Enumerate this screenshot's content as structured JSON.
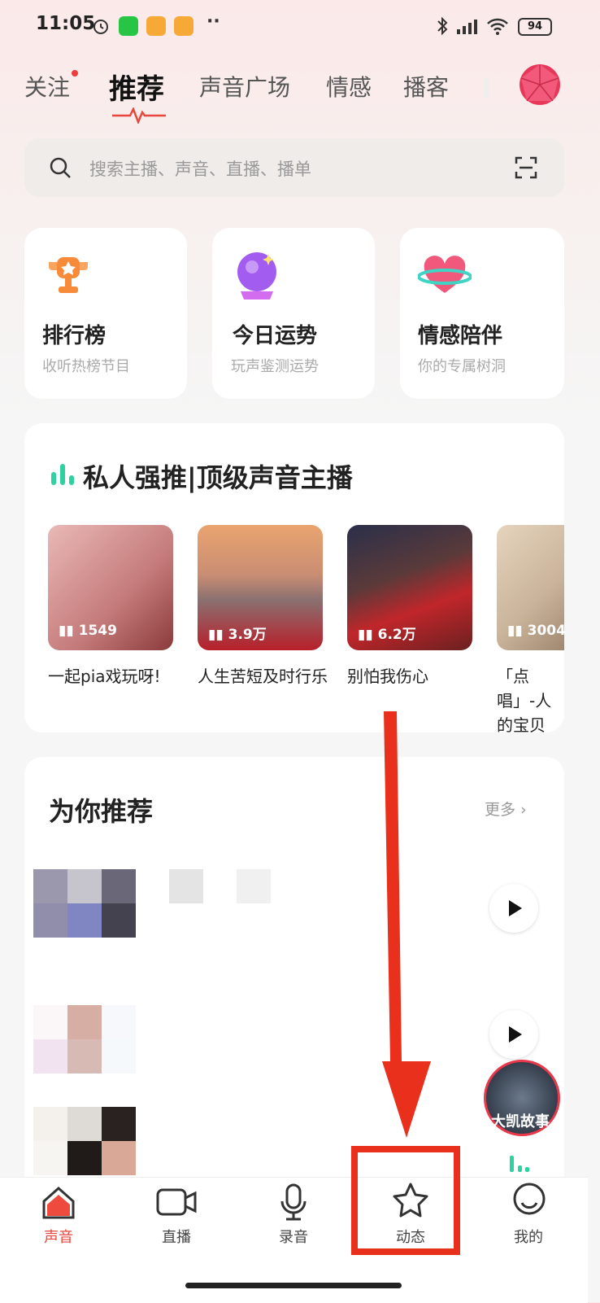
{
  "status_bar": {
    "time": "11:05",
    "battery": "94"
  },
  "tabs": [
    {
      "label": "关注"
    },
    {
      "label": "推荐"
    },
    {
      "label": "声音广场"
    },
    {
      "label": "情感"
    },
    {
      "label": "播客"
    }
  ],
  "search": {
    "placeholder": "搜索主播、声音、直播、播单"
  },
  "features": [
    {
      "title": "排行榜",
      "subtitle": "收听热榜节目",
      "icon": "trophy-icon"
    },
    {
      "title": "今日运势",
      "subtitle": "玩声鉴测运势",
      "icon": "crystal-ball-icon"
    },
    {
      "title": "情感陪伴",
      "subtitle": "你的专属树洞",
      "icon": "heart-planet-icon"
    }
  ],
  "private_section": {
    "title": "私人强推|顶级声音主播",
    "items": [
      {
        "count": "1549",
        "caption": "一起pia戏玩呀!",
        "color": "#d59c9c"
      },
      {
        "count": "3.9万",
        "caption": "人生苦短及时行乐",
        "color": "#a86a5c"
      },
      {
        "count": "6.2万",
        "caption": "别怕我伤心",
        "color": "#8c2a26"
      },
      {
        "count": "3004",
        "caption": "「点唱」-人的宝贝",
        "color": "#d8c6b1"
      }
    ]
  },
  "recommend": {
    "title": "为你推荐",
    "more": "更多"
  },
  "floating_badge": {
    "text": "大凯故事"
  },
  "nav": [
    {
      "label": "声音",
      "icon": "home-icon"
    },
    {
      "label": "直播",
      "icon": "video-icon"
    },
    {
      "label": "录音",
      "icon": "microphone-icon"
    },
    {
      "label": "动态",
      "icon": "star-icon"
    },
    {
      "label": "我的",
      "icon": "profile-icon"
    }
  ],
  "colors": {
    "accent": "#e8473e",
    "annotation": "#e8301c"
  }
}
